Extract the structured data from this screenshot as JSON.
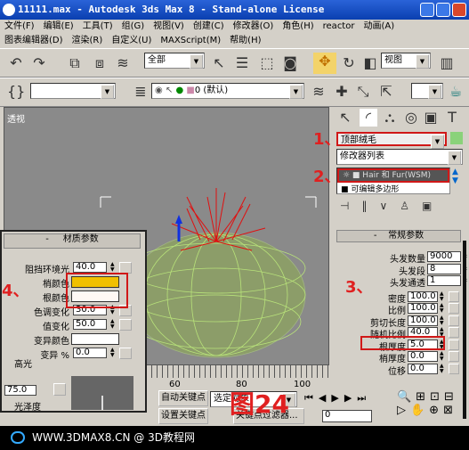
{
  "window": {
    "title": "11111.max - Autodesk 3ds Max 8  - Stand-alone License"
  },
  "menu": {
    "row1": [
      "文件(F)",
      "编辑(E)",
      "工具(T)",
      "组(G)",
      "视图(V)",
      "创建(C)",
      "修改器(O)",
      "角色(H)",
      "reactor",
      "动画(A)"
    ],
    "row2": [
      "图表编辑器(D)",
      "渲染(R)",
      "自定义(U)",
      "MAXScript(M)",
      "帮助(H)"
    ]
  },
  "toolbar": {
    "selection_filter": "全部",
    "ref_coord": "视图",
    "layer": "0 (默认)"
  },
  "viewport": {
    "label": "透视"
  },
  "command_panel": {
    "object_name": "顶部绒毛",
    "modifier_list": "修改器列表",
    "stack": [
      "Hair 和 Fur(WSM)",
      "可编辑多边形"
    ],
    "rollout_title": "常规参数",
    "params": [
      {
        "label": "头发数量",
        "value": "9000"
      },
      {
        "label": "头发段",
        "value": "8"
      },
      {
        "label": "头发通透",
        "value": "1"
      },
      {
        "label": "密度",
        "value": "100.0"
      },
      {
        "label": "比例",
        "value": "100.0"
      },
      {
        "label": "剪切长度",
        "value": "100.0"
      },
      {
        "label": "随机比例",
        "value": "40.0"
      },
      {
        "label": "根厚度",
        "value": "5.0"
      },
      {
        "label": "梢厚度",
        "value": "0.0"
      },
      {
        "label": "位移",
        "value": "0.0"
      }
    ]
  },
  "material": {
    "title": "材质参数",
    "occlusion_label": "阻挡环境光",
    "occlusion_value": "40.0",
    "tip_label": "梢颜色",
    "tip_color": "#f0c000",
    "root_label": "根颜色",
    "root_color": "#fff8f4",
    "hue_label": "色调变化",
    "hue_value": "30.0",
    "value_label": "值变化",
    "value_value": "50.0",
    "mutant_color_label": "变异颜色",
    "mutant_label": "变异 %",
    "mutant_value": "0.0",
    "specular_label": "高光",
    "specular_value": "75.0",
    "gloss_label": "光泽度"
  },
  "timeline": {
    "ticks": [
      "60",
      "80",
      "100"
    ],
    "auto_key": "自动关键点",
    "set_key": "设置关键点",
    "selected": "选定对象",
    "filters": "关键点过滤器...",
    "frame": "0"
  },
  "annotations": {
    "steps": [
      "1、",
      "2、",
      "3、",
      "4、"
    ],
    "figure": "图24"
  },
  "footer": {
    "text": "WWW.3DMAX8.CN @ 3D教程网"
  },
  "colors": {
    "title_bar": "#0a3fb0",
    "highlight": "#d01818",
    "tip": "#f0c000"
  }
}
